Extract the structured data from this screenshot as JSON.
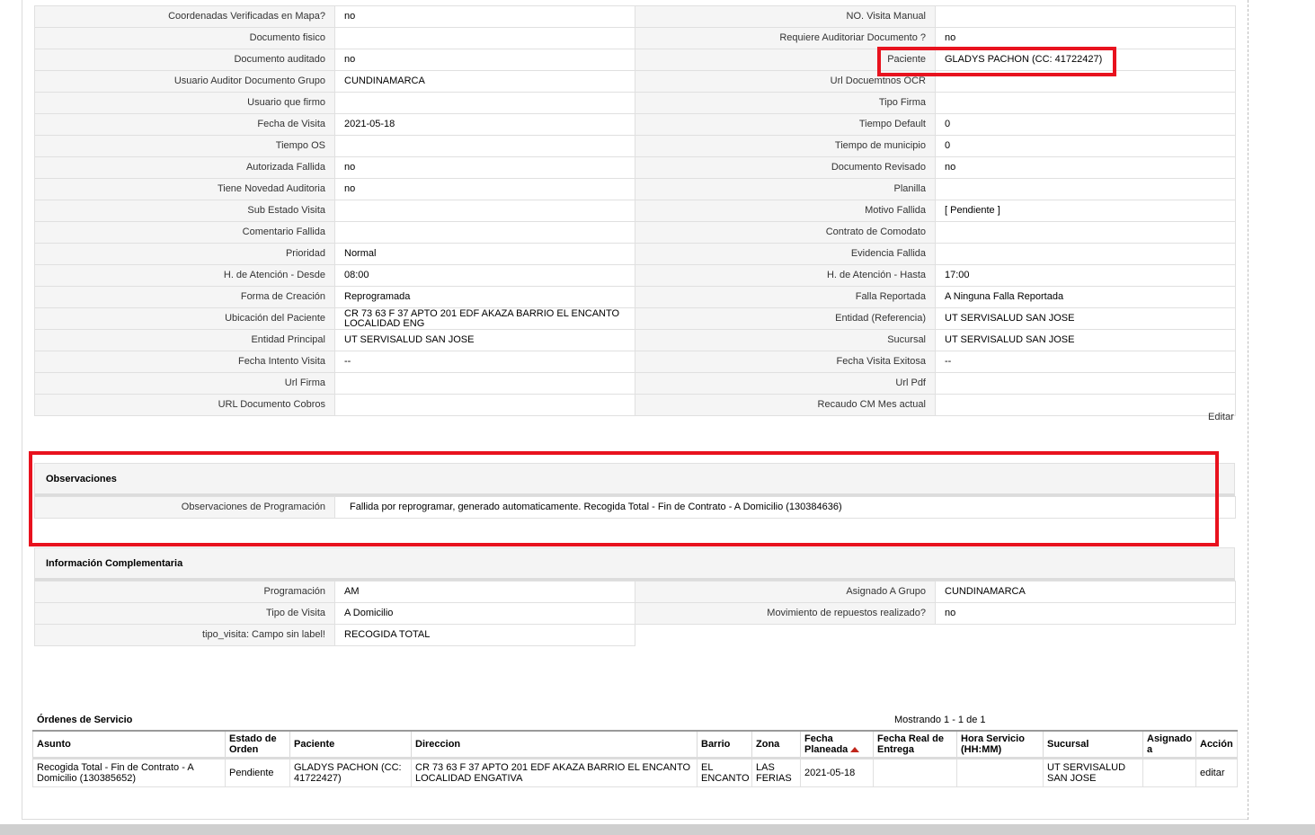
{
  "detail": {
    "rows": [
      [
        [
          "Coordenadas Verificadas en Mapa?",
          "no"
        ],
        [
          "NO. Visita Manual",
          ""
        ]
      ],
      [
        [
          "Documento fisico",
          ""
        ],
        [
          "Requiere Auditoriar Documento ?",
          "no"
        ]
      ],
      [
        [
          "Documento auditado",
          "no"
        ],
        [
          "Paciente",
          "GLADYS PACHON (CC: 41722427)"
        ]
      ],
      [
        [
          "Usuario Auditor Documento Grupo",
          "CUNDINAMARCA"
        ],
        [
          "Url Docuemtnos OCR",
          ""
        ]
      ],
      [
        [
          "Usuario que firmo",
          ""
        ],
        [
          "Tipo Firma",
          ""
        ]
      ],
      [
        [
          "Fecha de Visita",
          "2021-05-18"
        ],
        [
          "Tiempo Default",
          "0"
        ]
      ],
      [
        [
          "Tiempo OS",
          ""
        ],
        [
          "Tiempo de municipio",
          "0"
        ]
      ],
      [
        [
          "Autorizada Fallida",
          "no"
        ],
        [
          "Documento Revisado",
          "no"
        ]
      ],
      [
        [
          "Tiene Novedad Auditoria",
          "no"
        ],
        [
          "Planilla",
          ""
        ]
      ],
      [
        [
          "Sub Estado Visita",
          ""
        ],
        [
          "Motivo Fallida",
          "[ Pendiente ]"
        ]
      ],
      [
        [
          "Comentario Fallida",
          ""
        ],
        [
          "Contrato de Comodato",
          ""
        ]
      ],
      [
        [
          "Prioridad",
          "Normal"
        ],
        [
          "Evidencia Fallida",
          ""
        ]
      ],
      [
        [
          "H. de Atención - Desde",
          "08:00"
        ],
        [
          "H. de Atención - Hasta",
          "17:00"
        ]
      ],
      [
        [
          "Forma de Creación",
          "Reprogramada"
        ],
        [
          "Falla Reportada",
          "A Ninguna Falla Reportada"
        ]
      ],
      [
        [
          "Ubicación del Paciente",
          "CR 73 63 F 37 APTO 201 EDF AKAZA BARRIO EL ENCANTO LOCALIDAD ENG"
        ],
        [
          "Entidad (Referencia)",
          "UT SERVISALUD SAN JOSE"
        ]
      ],
      [
        [
          "Entidad Principal",
          "UT SERVISALUD SAN JOSE"
        ],
        [
          "Sucursal",
          "UT SERVISALUD SAN JOSE"
        ]
      ],
      [
        [
          "Fecha Intento Visita",
          "--"
        ],
        [
          "Fecha Visita Exitosa",
          "--"
        ]
      ],
      [
        [
          "Url Firma",
          ""
        ],
        [
          "Url Pdf",
          ""
        ]
      ],
      [
        [
          "URL Documento Cobros",
          ""
        ],
        [
          "Recaudo CM Mes actual",
          ""
        ]
      ]
    ],
    "edit_label": "Editar"
  },
  "observaciones": {
    "title": "Observaciones",
    "label": "Observaciones de Programación",
    "value": "Fallida por reprogramar, generado automaticamente. Recogida Total - Fin de Contrato - A Domicilio (130384636)"
  },
  "complementaria": {
    "title": "Información Complementaria",
    "rows": [
      [
        [
          "Programación",
          "AM"
        ],
        [
          "Asignado A Grupo",
          "CUNDINAMARCA"
        ]
      ],
      [
        [
          "Tipo de Visita",
          "A Domicilio"
        ],
        [
          "Movimiento de repuestos realizado?",
          "no"
        ]
      ],
      [
        [
          "tipo_visita: Campo sin label!",
          "RECOGIDA TOTAL"
        ],
        null
      ]
    ]
  },
  "orders": {
    "title": "Órdenes de Servicio",
    "count": "Mostrando 1 - 1 de 1",
    "columns": [
      "Asunto",
      "Estado de Orden",
      "Paciente",
      "Direccion",
      "Barrio",
      "Zona",
      "Fecha Planeada",
      "Fecha Real de Entrega",
      "Hora Servicio (HH:MM)",
      "Sucursal",
      "Asignado a",
      "Acción"
    ],
    "rows": [
      [
        "Recogida Total - Fin de Contrato - A Domicilio (130385652)",
        "Pendiente",
        "GLADYS PACHON (CC: 41722427)",
        "CR 73 63 F 37 APTO 201 EDF AKAZA BARRIO EL ENCANTO LOCALIDAD ENGATIVA",
        "EL ENCANTO",
        "LAS FERIAS",
        "2021-05-18",
        "",
        "",
        "UT SERVISALUD SAN JOSE",
        "",
        "editar"
      ]
    ]
  },
  "colors": {
    "highlight": "#e8121e",
    "sort_arrow": "#c0261b"
  }
}
